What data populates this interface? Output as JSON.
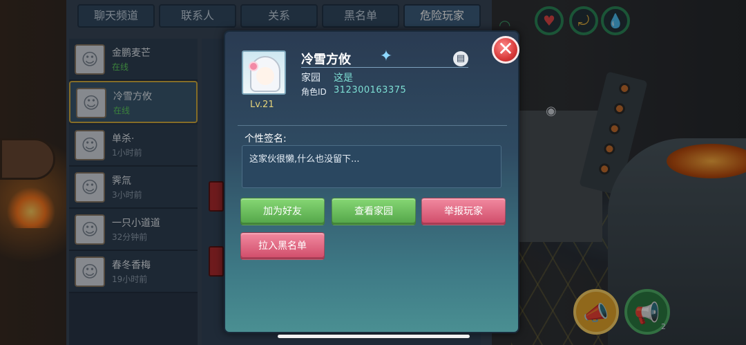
{
  "tabs": [
    "聊天频道",
    "联系人",
    "关系",
    "黑名单",
    "危险玩家"
  ],
  "active_tab_index": 4,
  "contacts": [
    {
      "name": "金鹏麦芒",
      "status": "在线",
      "online": true
    },
    {
      "name": "冷雪方攸",
      "status": "在线",
      "online": true,
      "selected": true
    },
    {
      "name": "单杀·",
      "status": "1小时前",
      "online": false
    },
    {
      "name": "霁氚",
      "status": "3小时前",
      "online": false
    },
    {
      "name": "一只小道道",
      "status": "32分钟前",
      "online": false
    },
    {
      "name": "春冬香梅",
      "status": "19小时前",
      "online": false
    }
  ],
  "profile": {
    "name": "冷雪方攸",
    "level": "Lv.21",
    "home_label": "家园",
    "home_value": "这是",
    "id_label": "角色ID",
    "id_value": "312300163375",
    "signature_label": "个性签名:",
    "signature": "这家伙很懒,什么也没留下..."
  },
  "buttons": {
    "add_friend": "加为好友",
    "view_home": "查看家园",
    "report": "举报玩家",
    "blacklist": "拉入黑名单",
    "close": "✕"
  },
  "hud": {
    "horn_count": "2"
  },
  "icons": {
    "close": "close-icon",
    "copy": "copy-icon",
    "heart": "heart-icon",
    "stamina": "stamina-icon",
    "water": "water-drop-icon",
    "horn": "megaphone-icon"
  },
  "colors": {
    "online": "#5fd060",
    "green_button": "#52a448",
    "red_button": "#cf4a68",
    "id_text": "#7ee0d4"
  }
}
